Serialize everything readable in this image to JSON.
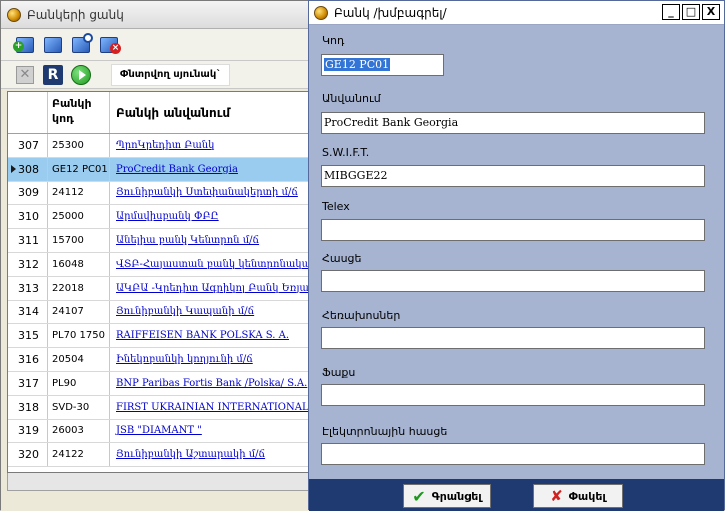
{
  "list_window": {
    "title": "Բանկերի ցանկ",
    "search_columns_label": "Փնտրվող սյունակ`",
    "columns": {
      "code": [
        "Բանկի",
        "կոդ"
      ],
      "name": "Բանկի անվանում"
    },
    "rows": [
      {
        "id": "307",
        "code": "25300",
        "name": "ՊրոԿրեդիտ Բանկ",
        "selected": false
      },
      {
        "id": "308",
        "code": "GE12 PC01",
        "name": "ProCredit Bank Georgia",
        "selected": true
      },
      {
        "id": "309",
        "code": "24112",
        "name": "Յունիբանկի Ստեփանակերտի մ/ճ",
        "selected": false
      },
      {
        "id": "310",
        "code": "25000",
        "name": "Արմսվիսբանկ ՓԲԸ",
        "selected": false
      },
      {
        "id": "311",
        "code": "15700",
        "name": "Անելիա բանկ Կենտրոն մ/ճ",
        "selected": false
      },
      {
        "id": "312",
        "code": "16048",
        "name": "ՎՏԲ-Հայաստան բանկ կենտրոնական",
        "selected": false
      },
      {
        "id": "313",
        "code": "22018",
        "name": "ԱԿԲԱ -Կրեդիտ Ագրիկոլ Բանկ Եռյա",
        "selected": false
      },
      {
        "id": "314",
        "code": "24107",
        "name": "Յունիբանկի Կապանի մ/ճ",
        "selected": false
      },
      {
        "id": "315",
        "code": "PL70 1750",
        "name": "RAIFFEISEN BANK POLSKA S. A.",
        "selected": false
      },
      {
        "id": "316",
        "code": "20504",
        "name": "Ինեկոբանկի կողյունի մ/ճ",
        "selected": false
      },
      {
        "id": "317",
        "code": "PL90",
        "name": "BNP Paribas Fortis Bank /Polska/ S.A.",
        "selected": false
      },
      {
        "id": "318",
        "code": "SVD-30",
        "name": "FIRST UKRAINIAN INTERNATIONAL B",
        "selected": false
      },
      {
        "id": "319",
        "code": "26003",
        "name": "JSB \"DIAMANT \"",
        "selected": false
      },
      {
        "id": "320",
        "code": "24122",
        "name": "Յունիբանկի Աշտարակի մ/ճ",
        "selected": false
      }
    ]
  },
  "dialog": {
    "title": "Բանկ /խմբագրել/",
    "window_buttons": {
      "minimize": "_",
      "maximize": "□",
      "close": "X"
    },
    "fields": {
      "code": {
        "label": "Կոդ",
        "value": "GE12 PC01"
      },
      "name": {
        "label": "Անվանում",
        "value": "ProCredit Bank Georgia"
      },
      "swift": {
        "label": "S.W.I.F.T.",
        "value": "MIBGGE22"
      },
      "telex": {
        "label": "Telex",
        "value": ""
      },
      "address": {
        "label": "Հասցե",
        "value": ""
      },
      "phones": {
        "label": "Հեռախոսներ",
        "value": ""
      },
      "fax": {
        "label": "Ֆաքս",
        "value": ""
      },
      "email": {
        "label": "Էլեկտրոնային հասցե",
        "value": ""
      }
    },
    "buttons": {
      "ok": "Գրանցել",
      "close": "Փակել"
    }
  }
}
